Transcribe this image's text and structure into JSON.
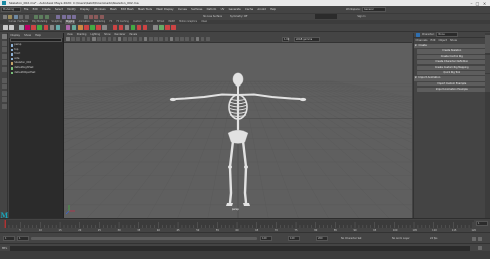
{
  "window": {
    "title": "Skeleton_002.ma* - Autodesk Maya 2020: C:\\Users\\Sabit\\Downloads\\Skeleton_002.ma"
  },
  "menubar": {
    "mode": "Modeling",
    "items": [
      "File",
      "Edit",
      "Create",
      "Select",
      "Modify",
      "Display",
      "Windows",
      "Mesh",
      "Edit Mesh",
      "Mesh Tools",
      "Mesh Display",
      "Curves",
      "Surfaces",
      "Deform",
      "UV",
      "Generate",
      "Cache",
      "Arnold",
      "Help"
    ],
    "workspace_label": "Workspace:",
    "workspace_value": "General"
  },
  "statusline": {
    "no_live_surface": "No Live Surface",
    "symmetry": "Symmetry: Off",
    "sign_in": "Sign In"
  },
  "shelf": {
    "tabs": [
      "Curves / Surfaces",
      "Poly Modeling",
      "Sculpting",
      "Rigging",
      "Animation",
      "Rendering",
      "FX",
      "FX Caching",
      "Custom",
      "Arnold",
      "Bifrost",
      "MASH",
      "Motion Graphics",
      "XGen"
    ],
    "active_tab": "Rigging"
  },
  "outliner": {
    "menus": [
      "Display",
      "Show",
      "Help"
    ],
    "search_placeholder": "Search...",
    "items": [
      "persp",
      "top",
      "front",
      "side",
      "Skeleton_002",
      "defaultLightSet",
      "defaultObjectSet"
    ]
  },
  "viewport": {
    "menus": [
      "View",
      "Shading",
      "Lighting",
      "Show",
      "Renderer",
      "Panels"
    ],
    "camera_label": "persp",
    "color_space": "sRGB gamma"
  },
  "right_panel": {
    "tabs": [
      "Channels",
      "Edit",
      "Object",
      "Show"
    ],
    "sections": [
      {
        "title": "Create",
        "buttons": [
          "Create Skeleton",
          "Create Control Rig",
          "Create Character Definition",
          "Create Custom Rig Mapping",
          "Quick Rig Tool"
        ]
      },
      {
        "title": "Import Animation",
        "buttons": [
          "Import Custom Example",
          "Import Animation Example"
        ]
      }
    ]
  },
  "timeline": {
    "ticks": [
      "5",
      "10",
      "15",
      "20",
      "25",
      "30",
      "35",
      "40",
      "45",
      "50",
      "55",
      "60",
      "65",
      "70",
      "75",
      "80",
      "85",
      "90",
      "95",
      "100",
      "105",
      "110",
      "115",
      "120"
    ],
    "current_frame": "1"
  },
  "range": {
    "start": "1",
    "start_inner": "1",
    "end_inner": "120",
    "end": "120",
    "end_outer": "200",
    "char_set": "No Character Set",
    "anim_layer": "No Anim Layer",
    "fps": "24 fps"
  },
  "cmdline": {
    "lang": "MEL"
  },
  "colors": {
    "viewport_bg": "#5f5f5f",
    "grid": "#555555",
    "bone": "#e2e2e2",
    "active_tab": "#5a5a5a",
    "maya_logo": "#1ba3b8"
  }
}
